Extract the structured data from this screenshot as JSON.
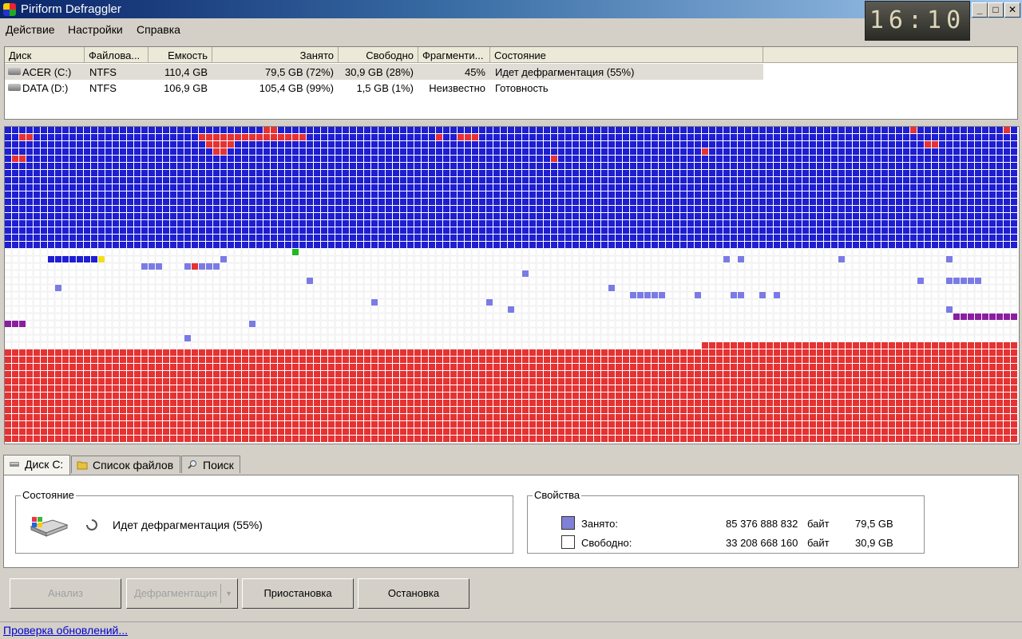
{
  "window": {
    "title": "Piriform Defraggler",
    "clock": "16:10"
  },
  "menu": [
    "Действие",
    "Настройки",
    "Справка"
  ],
  "disk_list": {
    "columns": [
      "Диск",
      "Файлова...",
      "Емкость",
      "Занято",
      "Свободно",
      "Фрагменти...",
      "Состояние"
    ],
    "rows": [
      {
        "disk": "ACER (C:)",
        "fs": "NTFS",
        "capacity": "110,4 GB",
        "used": "79,5 GB (72%)",
        "free": "30,9 GB (28%)",
        "fragmented": "45%",
        "status": "Идет дефрагментация (55%)",
        "selected": true
      },
      {
        "disk": "DATA (D:)",
        "fs": "NTFS",
        "capacity": "106,9 GB",
        "used": "105,4 GB (99%)",
        "free": "1,5 GB (1%)",
        "fragmented": "Неизвестно",
        "status": "Готовность",
        "selected": false
      }
    ]
  },
  "cluster_map_colors": {
    "used": "#1e1ed2",
    "fragmented": "#e63232",
    "free": "#ffffff",
    "light_used": "#7b7be6",
    "system": "#8a1fa0",
    "being_moved": "#22b722",
    "mft": "#f0e020"
  },
  "tabs": [
    "Диск C:",
    "Список файлов",
    "Поиск"
  ],
  "status_group": {
    "legend": "Состояние",
    "text": "Идет дефрагментация (55%)"
  },
  "properties_group": {
    "legend": "Свойства",
    "rows": [
      {
        "label": "Занято:",
        "bytes": "85 376 888 832",
        "unit": "байт",
        "size": "79,5 GB",
        "color": "#8080d8"
      },
      {
        "label": "Свободно:",
        "bytes": "33 208 668 160",
        "unit": "байт",
        "size": "30,9 GB",
        "color": "#ffffff"
      }
    ]
  },
  "buttons": {
    "analyze": "Анализ",
    "defrag": "Дефрагментация",
    "pause": "Приостановка",
    "stop": "Остановка"
  },
  "status_bar": {
    "update_link": "Проверка обновлений..."
  }
}
